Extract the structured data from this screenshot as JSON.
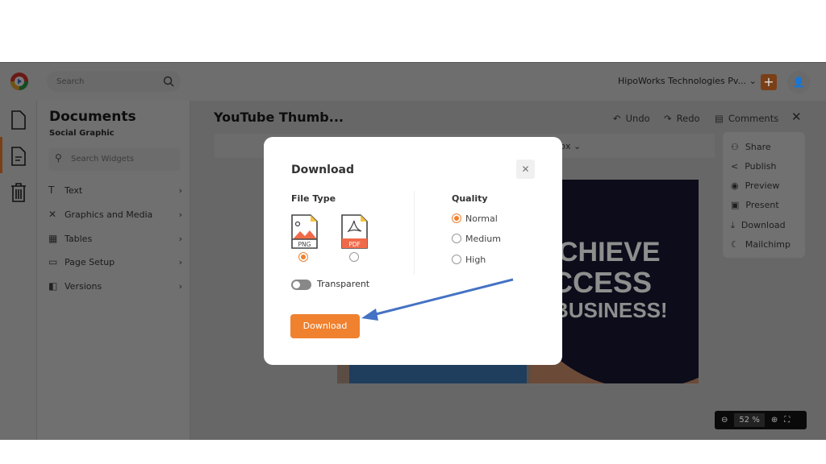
{
  "header": {
    "search_placeholder": "Search",
    "org": "HipoWorks Technologies Pv...",
    "add_icon": "plus-icon",
    "user_icon": "user-icon"
  },
  "rail": {
    "icons": [
      "file-icon",
      "document-icon",
      "trash-icon"
    ]
  },
  "panel": {
    "title": "Documents",
    "subtitle": "Social Graphic",
    "search_placeholder": "Search Widgets",
    "items": [
      {
        "label": "Text",
        "icon": "text-icon"
      },
      {
        "label": "Graphics and Media",
        "icon": "graphics-icon"
      },
      {
        "label": "Tables",
        "icon": "table-icon"
      },
      {
        "label": "Page Setup",
        "icon": "page-setup-icon"
      },
      {
        "label": "Versions",
        "icon": "versions-icon"
      }
    ]
  },
  "editor": {
    "doc_title": "YouTube Thumb...",
    "undo": "Undo",
    "redo": "Redo",
    "comments": "Comments",
    "size_unit": "px",
    "menu": [
      "Share",
      "Publish",
      "Preview",
      "Present",
      "Download",
      "Mailchimp"
    ],
    "thumbnail_lines": [
      "CHIEVE",
      "CCESS",
      "BUSINESS!"
    ],
    "zoom_value": "52",
    "zoom_unit": "%"
  },
  "modal": {
    "title": "Download",
    "file_type_label": "File Type",
    "file_types": [
      {
        "label": "PNG",
        "selected": true
      },
      {
        "label": "PDF",
        "selected": false
      }
    ],
    "quality_label": "Quality",
    "quality_options": [
      {
        "label": "Normal",
        "selected": true
      },
      {
        "label": "Medium",
        "selected": false
      },
      {
        "label": "High",
        "selected": false
      }
    ],
    "transparent_label": "Transparent",
    "transparent_on": false,
    "download_button": "Download"
  },
  "colors": {
    "accent": "#f0812f",
    "annotation_arrow": "#4472c4"
  }
}
